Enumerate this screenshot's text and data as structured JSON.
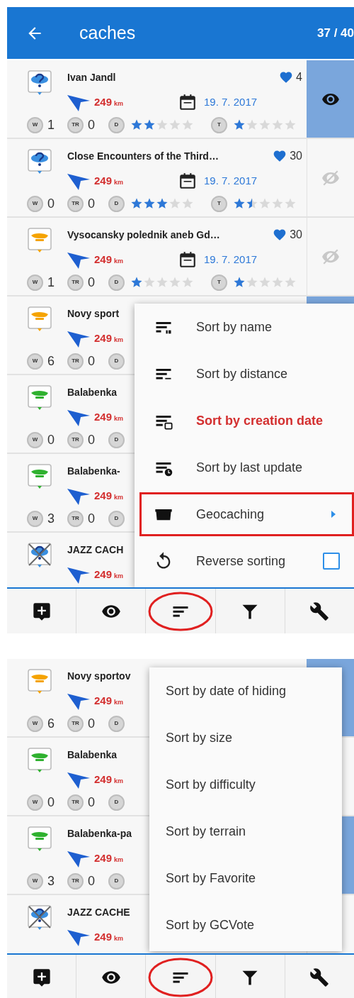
{
  "screens": [
    {
      "header": {
        "title": "caches",
        "count": "37 / 40"
      },
      "caches": [
        {
          "name": "Ivan Jandl",
          "kind": "mystery",
          "archived": false,
          "favorites": "4",
          "distance": "249",
          "unit": "km",
          "date": "19. 7. 2017",
          "stats": [
            {
              "label": "W",
              "value": "1"
            },
            {
              "label": "TR",
              "value": "0"
            }
          ],
          "difficulty": {
            "label": "D",
            "stars": 2
          },
          "terrain": {
            "label": "T",
            "stars": 1
          },
          "visible": true
        },
        {
          "name": "Close Encounters of the Third…",
          "kind": "mystery",
          "archived": false,
          "favorites": "30",
          "distance": "249",
          "unit": "km",
          "date": "19. 7. 2017",
          "stats": [
            {
              "label": "W",
              "value": "0"
            },
            {
              "label": "TR",
              "value": "0"
            }
          ],
          "difficulty": {
            "label": "D",
            "stars": 3
          },
          "terrain": {
            "label": "T",
            "stars": 1.5
          },
          "visible": false
        },
        {
          "name": "Vysocansky polednik aneb Gd…",
          "kind": "multi",
          "archived": false,
          "favorites": "30",
          "distance": "249",
          "unit": "km",
          "date": "19. 7. 2017",
          "stats": [
            {
              "label": "W",
              "value": "1"
            },
            {
              "label": "TR",
              "value": "0"
            }
          ],
          "difficulty": {
            "label": "D",
            "stars": 1
          },
          "terrain": {
            "label": "T",
            "stars": 1
          },
          "visible": false
        },
        {
          "name": "Novy sport",
          "kind": "multi",
          "archived": false,
          "distance": "249",
          "unit": "km",
          "stats": [
            {
              "label": "W",
              "value": "6"
            },
            {
              "label": "TR",
              "value": "0"
            }
          ],
          "difficulty": {
            "label": "D"
          },
          "visible": true
        },
        {
          "name": "Balabenka",
          "kind": "traditional",
          "archived": false,
          "distance": "249",
          "unit": "km",
          "stats": [
            {
              "label": "W",
              "value": "0"
            },
            {
              "label": "TR",
              "value": "0"
            }
          ],
          "difficulty": {
            "label": "D"
          }
        },
        {
          "name": "Balabenka-",
          "kind": "traditional",
          "archived": false,
          "distance": "249",
          "unit": "km",
          "stats": [
            {
              "label": "W",
              "value": "3"
            },
            {
              "label": "TR",
              "value": "0"
            }
          ],
          "difficulty": {
            "label": "D"
          }
        },
        {
          "name": "JAZZ CACH",
          "kind": "mystery",
          "archived": true,
          "distance": "249",
          "unit": "km"
        }
      ],
      "menu": {
        "items": [
          {
            "kind": "name",
            "label": "Sort by name",
            "selected": false
          },
          {
            "kind": "distance",
            "label": "Sort by distance",
            "selected": false
          },
          {
            "kind": "date",
            "label": "Sort by creation date",
            "selected": true
          },
          {
            "kind": "update",
            "label": "Sort by last update",
            "selected": false
          },
          {
            "kind": "submenu",
            "label": "Geocaching",
            "selected": false,
            "annotated": true
          },
          {
            "kind": "checkbox",
            "label": "Reverse sorting",
            "checked": false
          }
        ]
      },
      "toolbar": [
        {
          "kind": "add"
        },
        {
          "kind": "eye"
        },
        {
          "kind": "sort",
          "annotated": true
        },
        {
          "kind": "filter"
        },
        {
          "kind": "tools"
        }
      ]
    },
    {
      "caches": [
        {
          "name": "Novy sportov",
          "kind": "multi",
          "archived": false,
          "distance": "249",
          "unit": "km",
          "stats": [
            {
              "label": "W",
              "value": "6"
            },
            {
              "label": "TR",
              "value": "0"
            }
          ],
          "difficulty": {
            "label": "D"
          },
          "visible": true
        },
        {
          "name": "Balabenka",
          "kind": "traditional",
          "archived": false,
          "distance": "249",
          "unit": "km",
          "stats": [
            {
              "label": "W",
              "value": "0"
            },
            {
              "label": "TR",
              "value": "0"
            }
          ],
          "difficulty": {
            "label": "D"
          },
          "visible": false
        },
        {
          "name": "Balabenka-pa",
          "kind": "traditional",
          "archived": false,
          "distance": "249",
          "unit": "km",
          "stats": [
            {
              "label": "W",
              "value": "3"
            },
            {
              "label": "TR",
              "value": "0"
            }
          ],
          "difficulty": {
            "label": "D"
          },
          "visible": true
        },
        {
          "name": "JAZZ CACHE",
          "kind": "mystery",
          "archived": true,
          "distance": "249",
          "unit": "km",
          "visible": false
        }
      ],
      "menu": {
        "items": [
          {
            "kind": "plain",
            "label": "Sort by date of hiding"
          },
          {
            "kind": "plain",
            "label": "Sort by size"
          },
          {
            "kind": "plain",
            "label": "Sort by difficulty"
          },
          {
            "kind": "plain",
            "label": "Sort by terrain"
          },
          {
            "kind": "plain",
            "label": "Sort by Favorite"
          },
          {
            "kind": "plain",
            "label": "Sort by GCVote"
          }
        ]
      },
      "toolbar": [
        {
          "kind": "add"
        },
        {
          "kind": "eye"
        },
        {
          "kind": "sort",
          "annotated": true
        },
        {
          "kind": "filter"
        },
        {
          "kind": "tools"
        }
      ]
    }
  ]
}
